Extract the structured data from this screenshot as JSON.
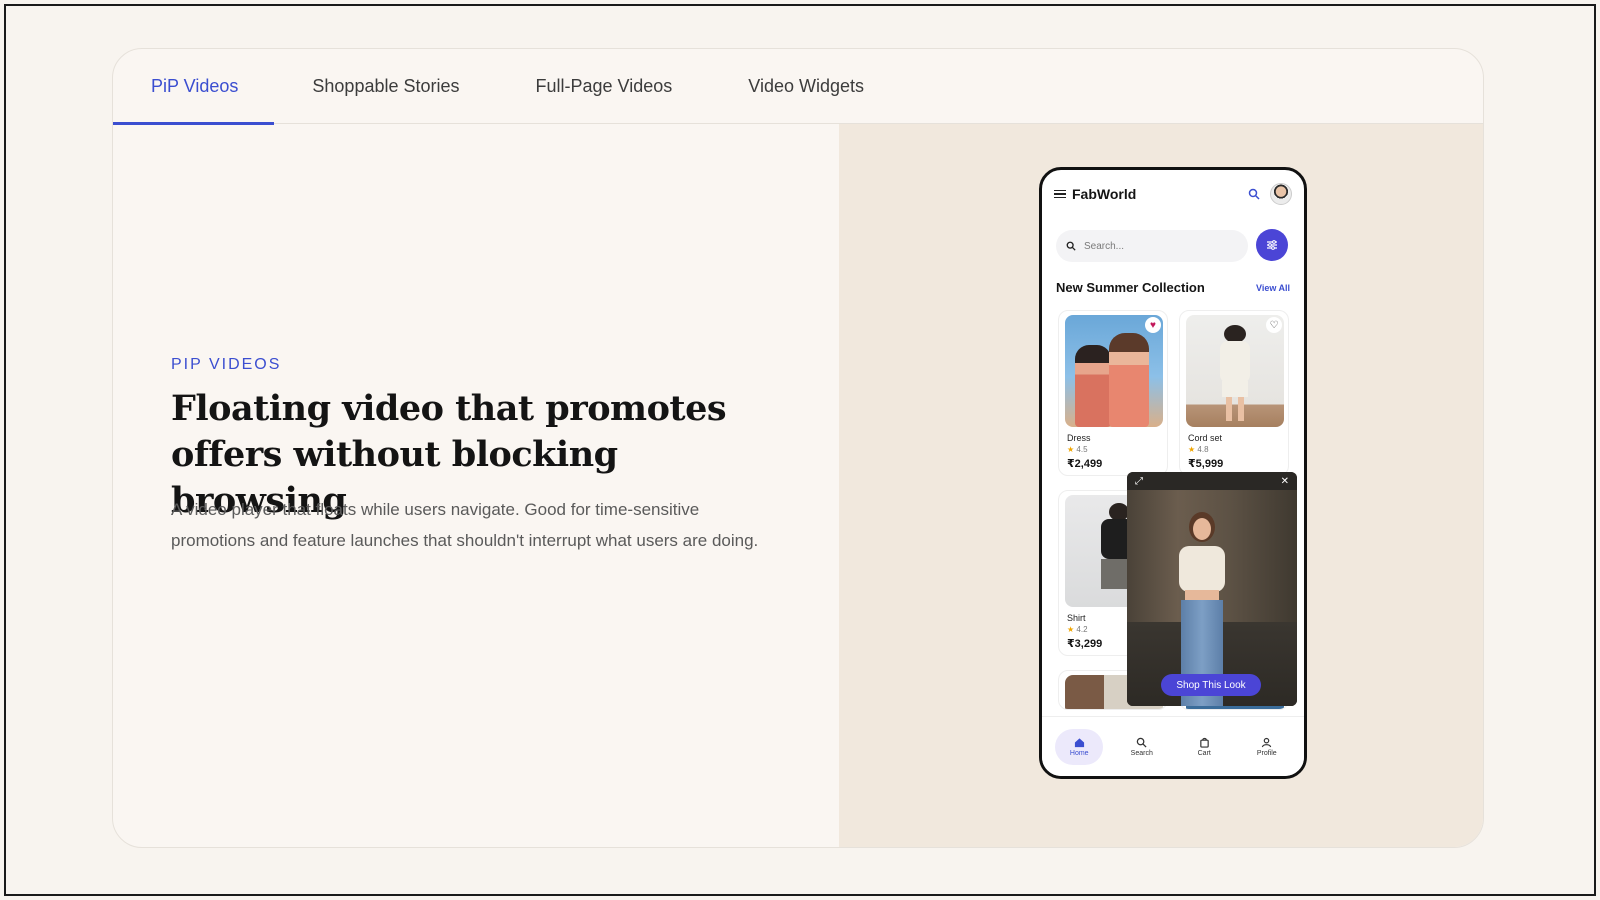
{
  "tabs": [
    {
      "label": "PiP Videos",
      "active": true
    },
    {
      "label": "Shoppable Stories",
      "active": false
    },
    {
      "label": "Full-Page Videos",
      "active": false
    },
    {
      "label": "Video Widgets",
      "active": false
    }
  ],
  "content": {
    "eyebrow": "PIP VIDEOS",
    "headline": "Floating video that promotes offers without blocking browsing",
    "description": "A video player that floats while users navigate. Good for time-sensitive promotions and feature launches that shouldn't interrupt what users are doing."
  },
  "phone": {
    "brand": "FabWorld",
    "search_placeholder": "Search...",
    "section_title": "New Summer Collection",
    "view_all": "View All",
    "products": [
      {
        "name": "Dress",
        "rating": "4.5",
        "price": "₹2,499",
        "favorited": true
      },
      {
        "name": "Cord set",
        "rating": "4.8",
        "price": "₹5,999",
        "favorited": false
      },
      {
        "name": "Shirt",
        "rating": "4.2",
        "price": "₹3,299",
        "favorited": false
      }
    ],
    "pip": {
      "expand_icon": "expand-icon",
      "close_icon": "close-icon",
      "cta": "Shop This Look"
    },
    "nav": [
      {
        "label": "Home",
        "icon": "home-icon",
        "active": true
      },
      {
        "label": "Search",
        "icon": "search-icon",
        "active": false
      },
      {
        "label": "Cart",
        "icon": "cart-icon",
        "active": false
      },
      {
        "label": "Profile",
        "icon": "profile-icon",
        "active": false
      }
    ]
  },
  "colors": {
    "accent": "#3b4ed0",
    "button": "#4b45d6",
    "page_bg": "#f8f4ef",
    "panel_bg": "#f1e8dd"
  }
}
